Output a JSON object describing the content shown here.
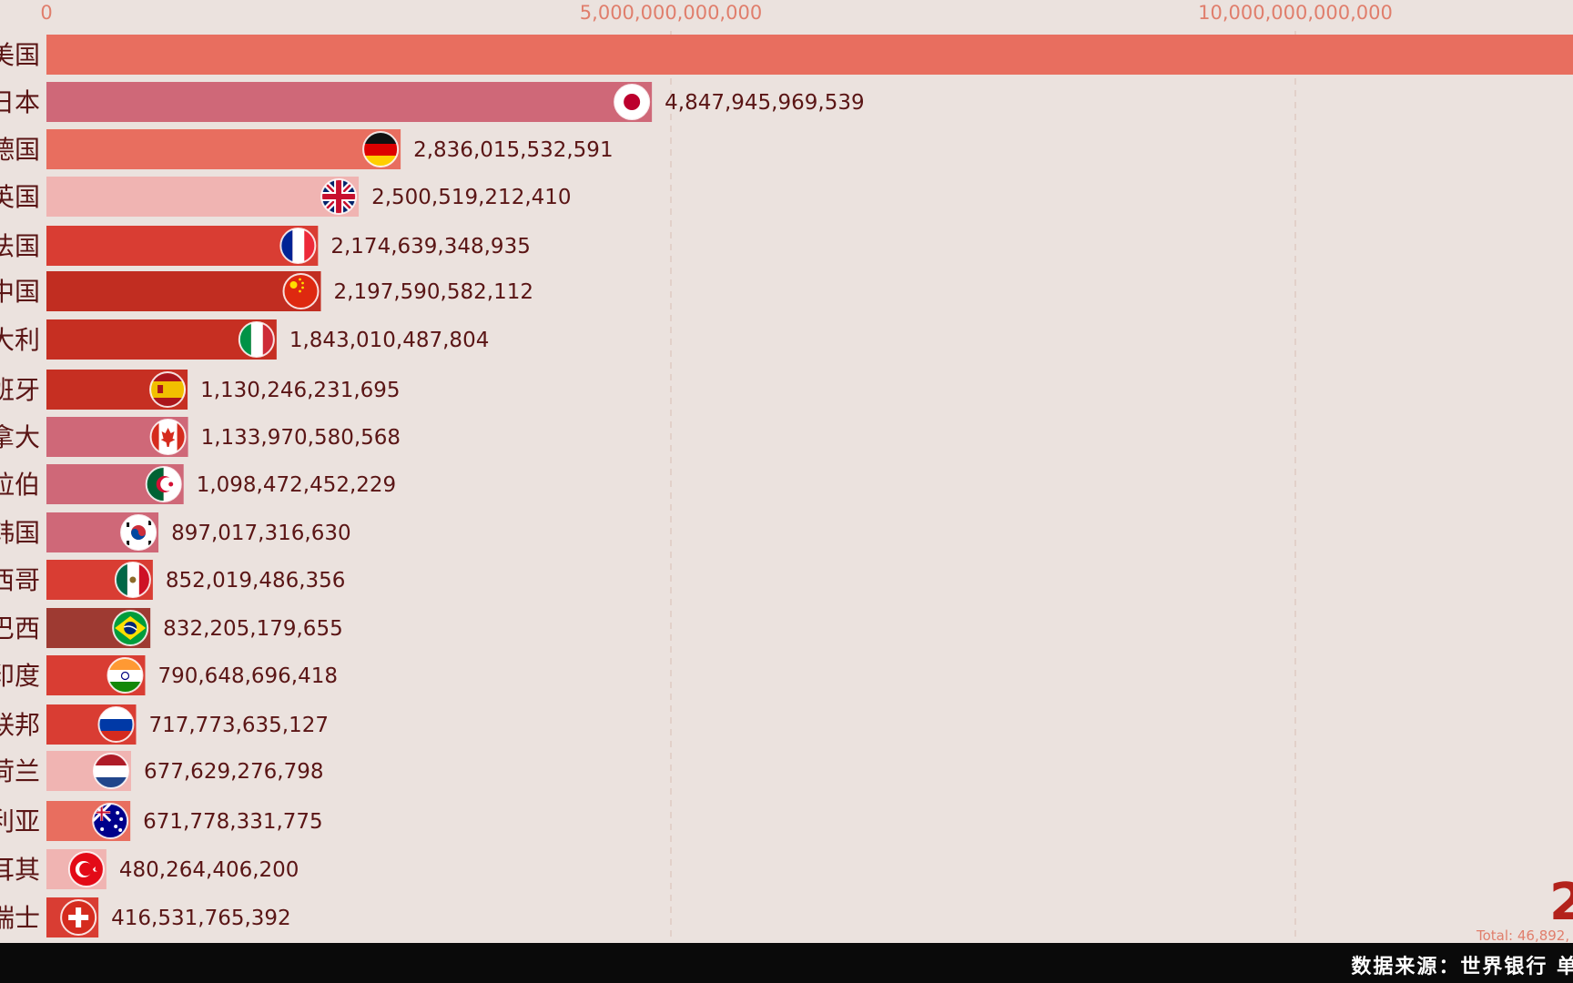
{
  "chart_data": {
    "type": "bar",
    "orientation": "horizontal",
    "axis_ticks": [
      {
        "value": 0,
        "label": "0"
      },
      {
        "value": 5000000000000,
        "label": "5,000,000,000,000"
      },
      {
        "value": 10000000000000,
        "label": "10,000,000,000,000"
      }
    ],
    "xlim": [
      0,
      12500000000000
    ],
    "grid": true,
    "bars": [
      {
        "label": "美国",
        "value": 12500000000000,
        "value_label": "",
        "color": "#e86e5f",
        "flag": ""
      },
      {
        "label": "日本",
        "value": 4847945969539,
        "value_label": "4,847,945,969,539",
        "color": "#cf6878",
        "flag": "japan"
      },
      {
        "label": "德国",
        "value": 2836015532591,
        "value_label": "2,836,015,532,591",
        "color": "#e86e5f",
        "flag": "germany"
      },
      {
        "label": "英国",
        "value": 2500519212410,
        "value_label": "2,500,519,212,410",
        "color": "#f0b4b2",
        "flag": "uk"
      },
      {
        "label": "法国",
        "value": 2174639348935,
        "value_label": "2,174,639,348,935",
        "color": "#d93d33",
        "flag": "france"
      },
      {
        "label": "中国",
        "value": 2197590582112,
        "value_label": "2,197,590,582,112",
        "color": "#c12d21",
        "flag": "china"
      },
      {
        "label": "大利",
        "value": 1843010487804,
        "value_label": "1,843,010,487,804",
        "color": "#c62f22",
        "flag": "italy"
      },
      {
        "label": "班牙",
        "value": 1130246231695,
        "value_label": "1,130,246,231,695",
        "color": "#c62f22",
        "flag": "spain"
      },
      {
        "label": "拿大",
        "value": 1133970580568,
        "value_label": "1,133,970,580,568",
        "color": "#cf6878",
        "flag": "canada"
      },
      {
        "label": "拉伯",
        "value": 1098472452229,
        "value_label": "1,098,472,452,229",
        "color": "#cf6878",
        "flag": "algeria"
      },
      {
        "label": "韩国",
        "value": 897017316630,
        "value_label": "897,017,316,630",
        "color": "#cf6878",
        "flag": "korea"
      },
      {
        "label": "西哥",
        "value": 852019486356,
        "value_label": "852,019,486,356",
        "color": "#d93d33",
        "flag": "mexico"
      },
      {
        "label": "巴西",
        "value": 832205179655,
        "value_label": "832,205,179,655",
        "color": "#9e3a32",
        "flag": "brazil"
      },
      {
        "label": "印度",
        "value": 790648696418,
        "value_label": "790,648,696,418",
        "color": "#d93d33",
        "flag": "india"
      },
      {
        "label": "联邦",
        "value": 717773635127,
        "value_label": "717,773,635,127",
        "color": "#d93d33",
        "flag": "russia"
      },
      {
        "label": "荷兰",
        "value": 677629276798,
        "value_label": "677,629,276,798",
        "color": "#f0b4b2",
        "flag": "netherlands"
      },
      {
        "label": "利亚",
        "value": 671778331775,
        "value_label": "671,778,331,775",
        "color": "#e86e5f",
        "flag": "australia"
      },
      {
        "label": "耳其",
        "value": 480264406200,
        "value_label": "480,264,406,200",
        "color": "#f0b4b2",
        "flag": "turkey"
      },
      {
        "label": "瑞士",
        "value": 416531765392,
        "value_label": "416,531,765,392",
        "color": "#d93d33",
        "flag": "switzerland"
      }
    ],
    "year": "2",
    "total": "Total: 46,892,"
  },
  "footer": {
    "source": "数据来源：世界银行 单位"
  }
}
